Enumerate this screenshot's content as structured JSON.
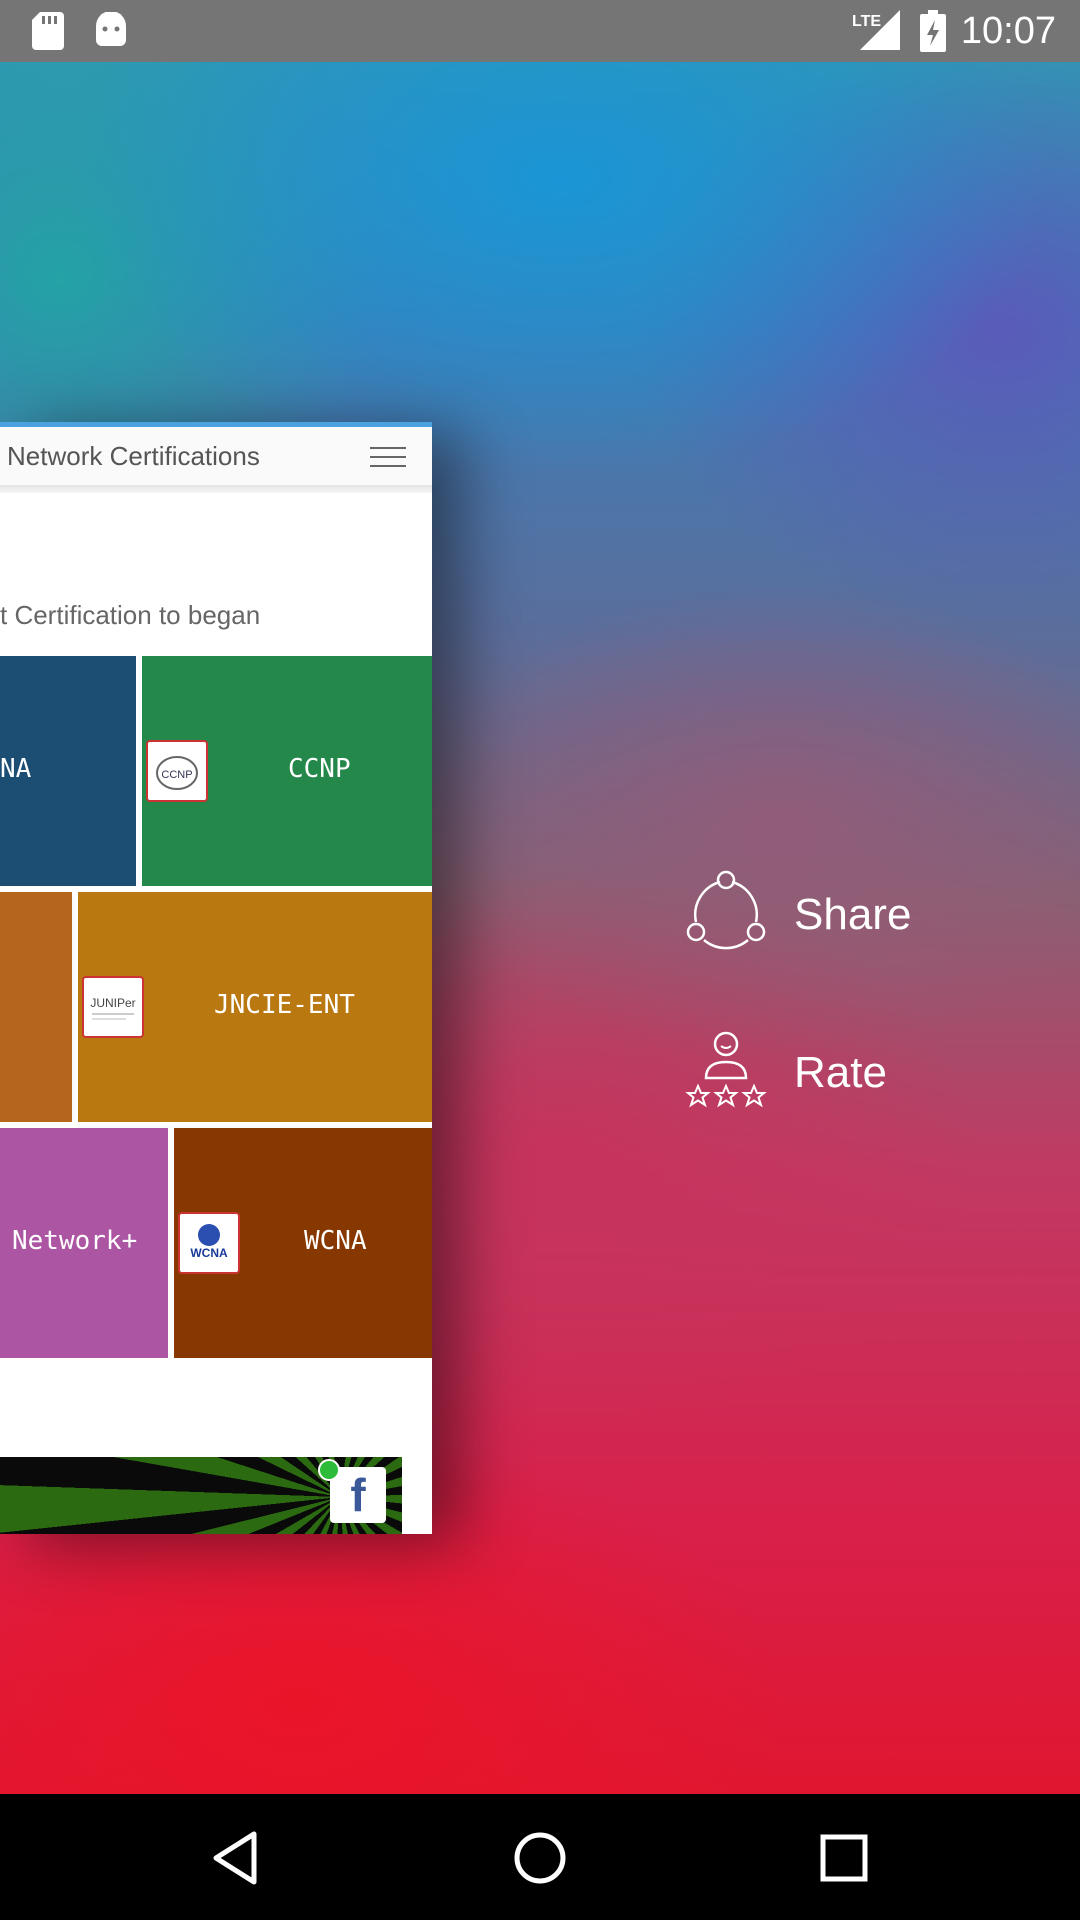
{
  "status_bar": {
    "time": "10:07",
    "network": "LTE",
    "left_icons": [
      "sd-card-icon",
      "android-icon"
    ],
    "right_icons": [
      "lte-signal-icon",
      "battery-charging-icon"
    ]
  },
  "card": {
    "title": "Network Certifications",
    "prompt": "t  Certification to began",
    "accent_color": "#4aa3df",
    "tiles": [
      {
        "label": "NA",
        "color": "#1c4d73"
      },
      {
        "label": "CCNP",
        "color": "#23884a",
        "badge": "CCNP"
      },
      {
        "label": "",
        "color": "#b6651c"
      },
      {
        "label": "JNCIE-ENT",
        "color": "#b97810",
        "badge": "JUNIPer"
      },
      {
        "label": "Network+",
        "color": "#ab55a3"
      },
      {
        "label": "WCNA",
        "color": "#873800",
        "badge": "WCNA"
      }
    ],
    "ad": {
      "icon": "facebook-icon",
      "glyph": "f"
    }
  },
  "menu": {
    "share_label": "Share",
    "rate_label": "Rate"
  },
  "nav": [
    "back-icon",
    "home-icon",
    "recents-icon"
  ]
}
